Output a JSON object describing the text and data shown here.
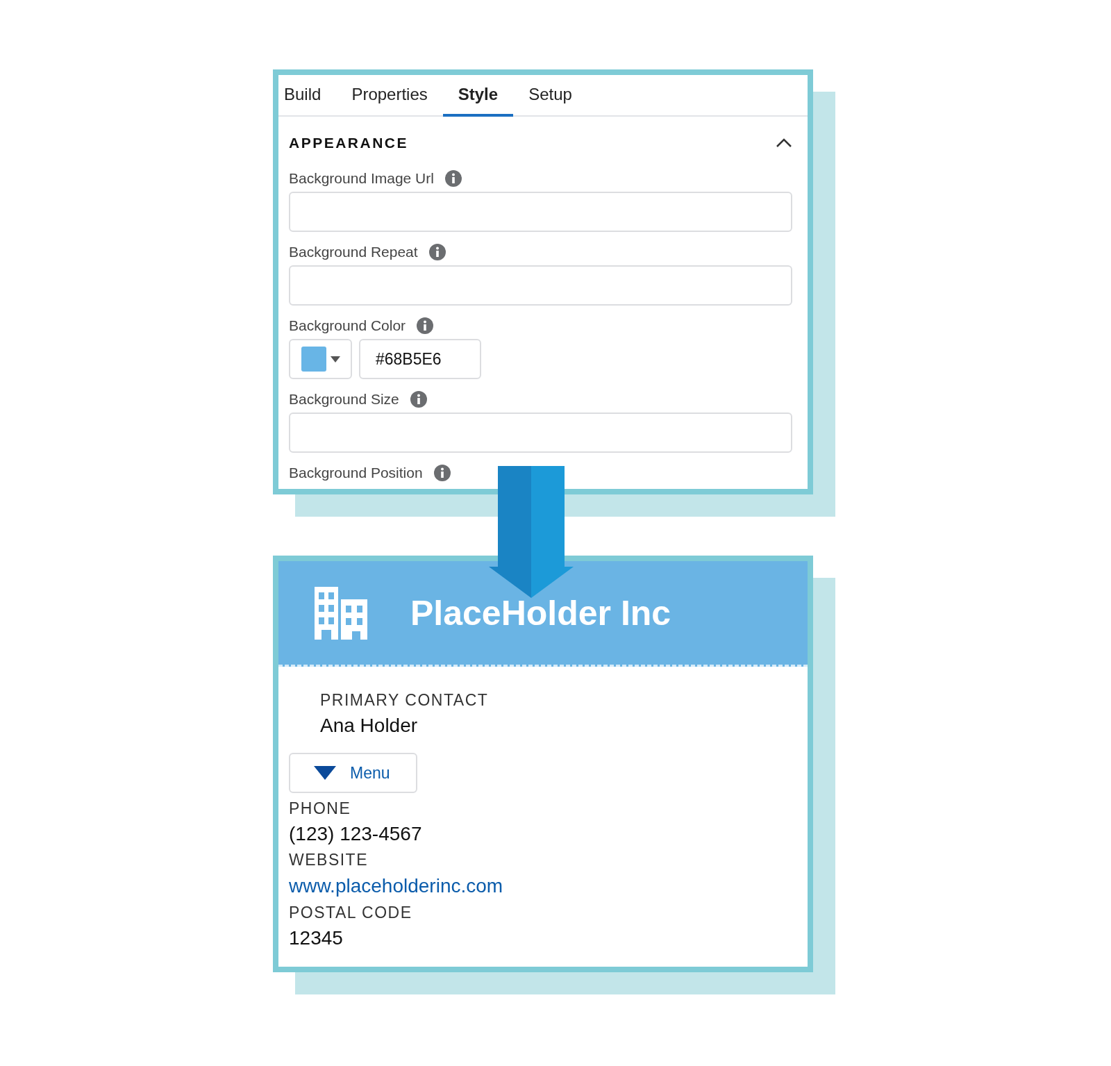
{
  "style_panel": {
    "tabs": [
      {
        "label": "Build",
        "selected": false
      },
      {
        "label": "Properties",
        "selected": false
      },
      {
        "label": "Style",
        "selected": true
      },
      {
        "label": "Setup",
        "selected": false
      }
    ],
    "section": {
      "title": "APPEARANCE",
      "expanded": true
    },
    "fields": [
      {
        "kind": "text",
        "label": "Background Image Url"
      },
      {
        "kind": "text",
        "label": "Background Repeat"
      },
      {
        "kind": "color",
        "label": "Background Color",
        "value": "#68B5E6",
        "color": "#68b5e6"
      },
      {
        "kind": "text",
        "label": "Background Size"
      },
      {
        "kind": "label",
        "label": "Background Position"
      }
    ]
  },
  "account_card": {
    "name": "PlaceHolder Inc",
    "primary_contact": {
      "label": "PRIMARY CONTACT",
      "value": "Ana Holder"
    },
    "menu_button": "Menu",
    "fields": [
      {
        "kind": "text",
        "label": "PHONE",
        "value": "(123) 123-4567"
      },
      {
        "kind": "link",
        "label": "WEBSITE",
        "value": "www.placeholderinc.com"
      },
      {
        "kind": "text",
        "label": "POSTAL CODE",
        "value": "12345"
      }
    ]
  }
}
